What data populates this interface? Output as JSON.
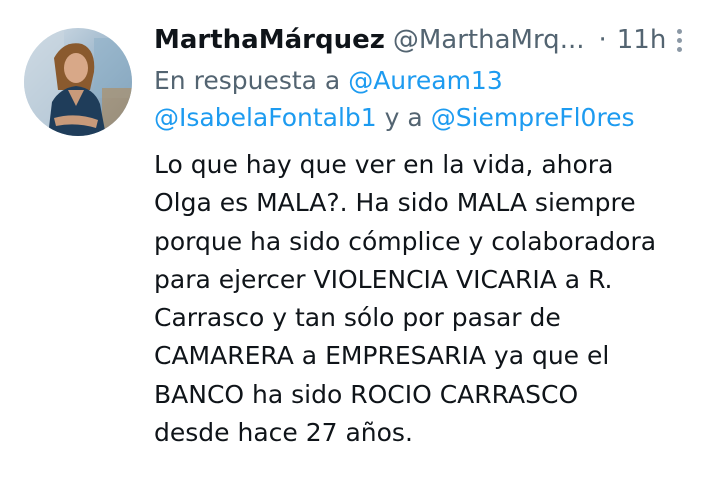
{
  "tweet": {
    "author_name": "MarthaMárquez",
    "author_handle": "@MarthaMrq...",
    "separator": "·",
    "timestamp": "11h",
    "more_icon": "more-vertical-icon",
    "reply_prefix": "En respuesta a",
    "mentions": [
      "@Auream13",
      "@IsabelaFontalb1",
      "@SiempreFl0res"
    ],
    "reply_conjunction": "y a",
    "body_lines": [
      "Lo que hay que ver en la vida, ahora",
      "Olga es MALA?. Ha sido MALA siempre",
      "porque ha sido cómplice y colaboradora",
      "para ejercer VIOLENCIA VICARIA a R.",
      "Carrasco y tan sólo por pasar de",
      "CAMARERA a EMPRESARIA ya que el",
      "BANCO ha sido ROCIO CARRASCO",
      "desde hace 27 años."
    ]
  },
  "colors": {
    "text": "#0f1419",
    "secondary": "#536471",
    "link": "#1d9bf0"
  }
}
